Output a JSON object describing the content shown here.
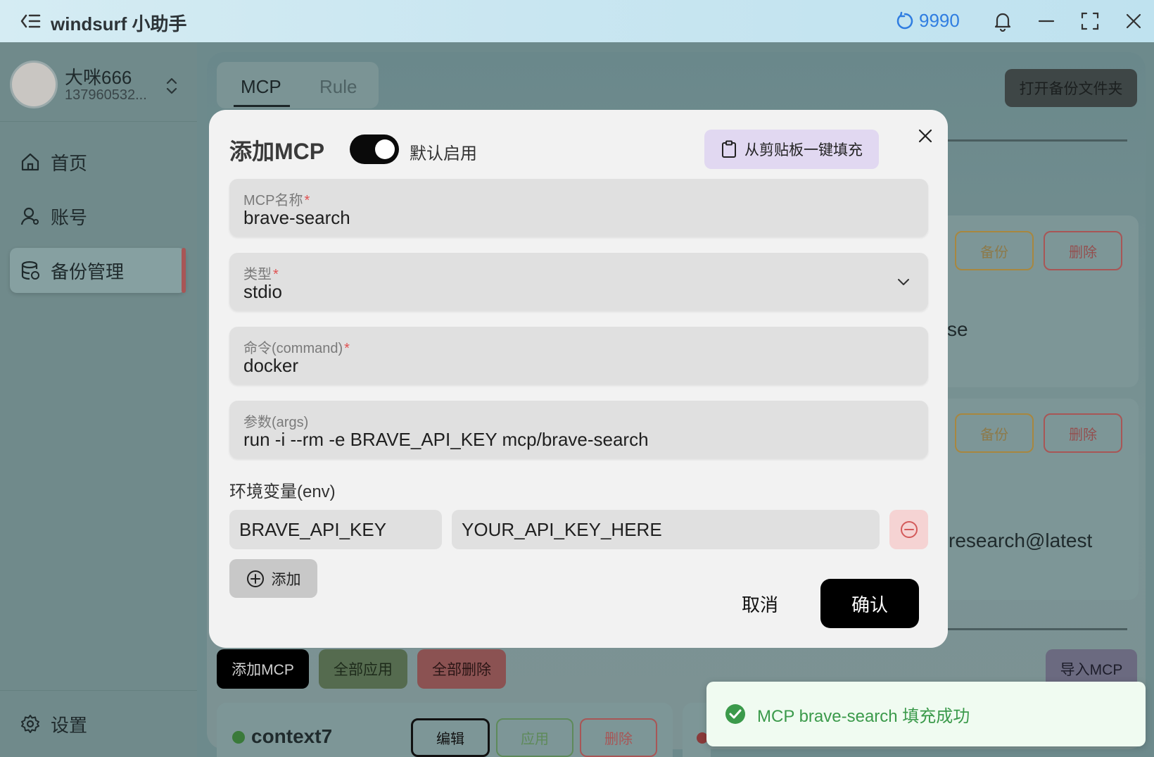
{
  "titlebar": {
    "title": "windsurf 小助手",
    "credits": "9990"
  },
  "sidebar": {
    "user_name": "大咪666",
    "user_id": "137960532...",
    "items": [
      {
        "label": "首页",
        "icon": "home-icon"
      },
      {
        "label": "账号",
        "icon": "user-icon"
      },
      {
        "label": "备份管理",
        "icon": "database-icon",
        "active": true
      }
    ],
    "settings_label": "设置"
  },
  "main": {
    "tabs": [
      {
        "label": "MCP"
      },
      {
        "label": "Rule"
      }
    ],
    "open_backup_folder": "打开备份文件夹",
    "cards": [
      {
        "backup": "备份",
        "delete": "删除",
        "text": "se"
      },
      {
        "backup": "备份",
        "delete": "删除",
        "text": "research@latest"
      }
    ],
    "bottom": {
      "add_mcp": "添加MCP",
      "apply_all": "全部应用",
      "delete_all": "全部删除",
      "import_mcp": "导入MCP"
    },
    "list_item": {
      "name": "context7",
      "edit": "编辑",
      "apply": "应用",
      "delete": "删除"
    }
  },
  "modal": {
    "title": "添加MCP",
    "default_enabled_label": "默认启用",
    "default_enabled": true,
    "paste_button": "从剪贴板一键填充",
    "fields": {
      "name": {
        "label": "MCP名称",
        "required": "*",
        "value": "brave-search"
      },
      "type": {
        "label": "类型",
        "required": "*",
        "value": "stdio"
      },
      "command": {
        "label": "命令(command)",
        "required": "*",
        "value": "docker"
      },
      "args": {
        "label": "参数(args)",
        "value": "run -i --rm -e BRAVE_API_KEY mcp/brave-search"
      }
    },
    "env_label": "环境变量(env)",
    "env": [
      {
        "key": "BRAVE_API_KEY",
        "value": "YOUR_API_KEY_HERE"
      }
    ],
    "add_label": "添加",
    "cancel": "取消",
    "confirm": "确认"
  },
  "toast": {
    "message": "MCP brave-search 填充成功"
  },
  "colors": {
    "accent_blue": "#2f7de1",
    "success_green": "#3b9a4b",
    "danger_red": "#e05252",
    "paste_purple": "#e1d8f1"
  }
}
